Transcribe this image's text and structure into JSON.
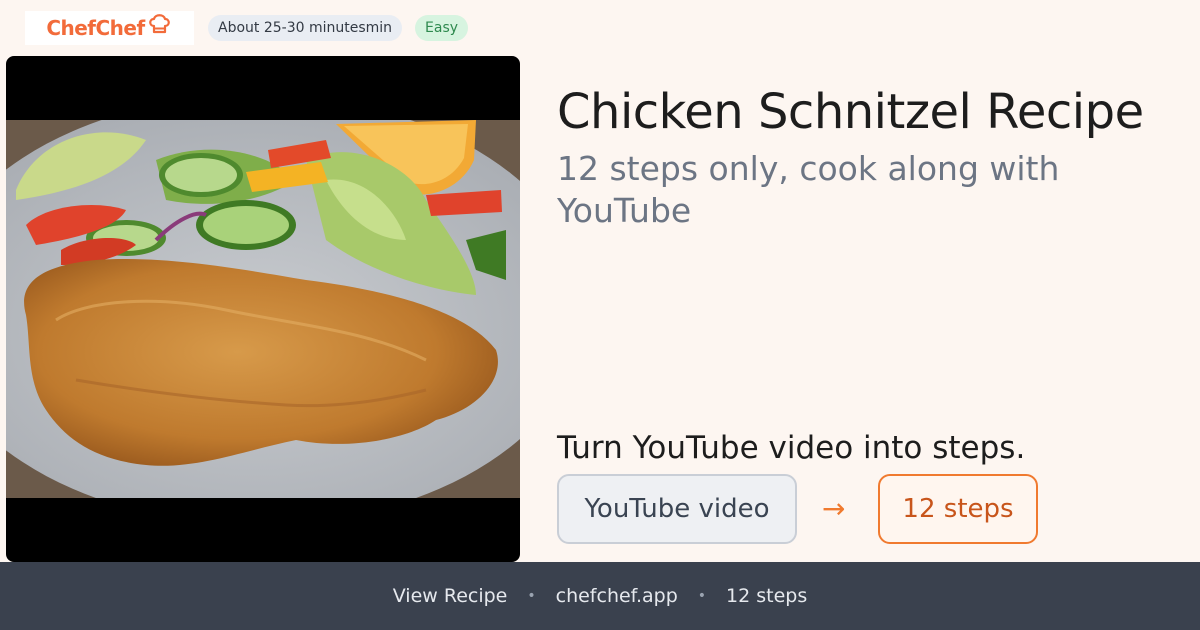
{
  "brand": {
    "name": "ChefChef",
    "color": "#f26b3a",
    "icon": "chef-hat-icon"
  },
  "meta": {
    "time": "About 25-30 minutesmin",
    "difficulty": "Easy"
  },
  "recipe": {
    "title": "Chicken Schnitzel Recipe",
    "subtitle": "12 steps only, cook along with YouTube",
    "image": "chicken schnitzel with salad and orange slice"
  },
  "promo": {
    "text": "Turn YouTube video into steps.",
    "from_label": "YouTube video",
    "arrow": "→",
    "to_label": "12 steps"
  },
  "footer": {
    "items": [
      "View Recipe",
      "chefchef.app",
      "12 steps"
    ],
    "separator": "•"
  },
  "colors": {
    "accent": "#f07a2f",
    "background": "#fdf6f1",
    "footer_bg": "#3a414e",
    "easy_badge": "#d7f4e0"
  }
}
